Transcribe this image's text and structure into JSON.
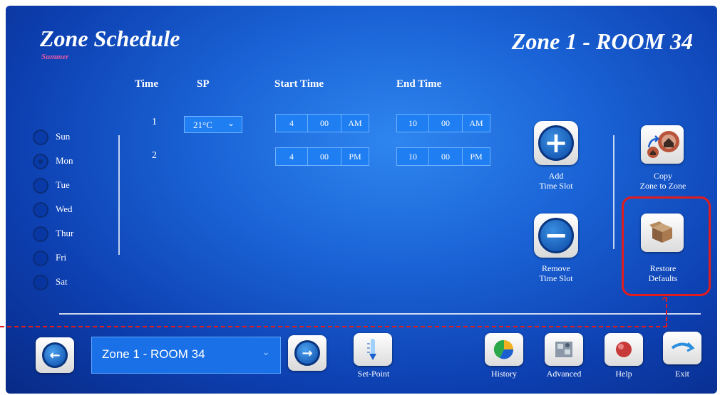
{
  "header": {
    "title": "Zone Schedule",
    "season": "Summer",
    "zone_title": "Zone 1 - ROOM 34"
  },
  "columns": {
    "time": "Time",
    "sp": "SP",
    "start": "Start Time",
    "end": "End Time"
  },
  "days": [
    {
      "label": "Sun",
      "selected": false
    },
    {
      "label": "Mon",
      "selected": true
    },
    {
      "label": "Tue",
      "selected": false
    },
    {
      "label": "Wed",
      "selected": false
    },
    {
      "label": "Thur",
      "selected": false
    },
    {
      "label": "Fri",
      "selected": false
    },
    {
      "label": "Sat",
      "selected": false
    }
  ],
  "slots": [
    {
      "num": "1",
      "sp": "21°C",
      "start": {
        "h": "4",
        "m": "00",
        "ap": "AM"
      },
      "end": {
        "h": "10",
        "m": "00",
        "ap": "AM"
      }
    },
    {
      "num": "2",
      "start": {
        "h": "4",
        "m": "00",
        "ap": "PM"
      },
      "end": {
        "h": "10",
        "m": "00",
        "ap": "PM"
      }
    }
  ],
  "actions": {
    "add_line1": "Add",
    "add_line2": "Time Slot",
    "remove_line1": "Remove",
    "remove_line2": "Time Slot",
    "copy_line1": "Copy",
    "copy_line2": "Zone to Zone",
    "restore_line1": "Restore",
    "restore_line2": "Defaults"
  },
  "footer": {
    "zone_select": "Zone 1 - ROOM 34",
    "setpoint": "Set-Point",
    "history": "History",
    "advanced": "Advanced",
    "help": "Help",
    "exit": "Exit"
  },
  "colors": {
    "highlight": "#e21c1c",
    "field": "#1f7ef2"
  }
}
